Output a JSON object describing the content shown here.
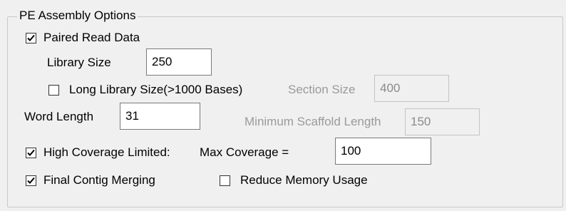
{
  "group": {
    "title": "PE Assembly Options"
  },
  "paired_read": {
    "label": "Paired Read Data",
    "checked": true
  },
  "library_size": {
    "label": "Library Size",
    "value": "250"
  },
  "long_library": {
    "label": "Long Library Size(>1000 Bases)",
    "checked": false
  },
  "section_size": {
    "label": "Section Size",
    "value": "400",
    "enabled": false
  },
  "word_length": {
    "label": "Word Length",
    "value": "31"
  },
  "min_scaffold": {
    "label": "Minimum Scaffold Length",
    "value": "150",
    "enabled": false
  },
  "high_coverage": {
    "label": "High Coverage Limited:",
    "checked": true
  },
  "max_coverage": {
    "label": "Max Coverage =",
    "value": "100"
  },
  "final_merging": {
    "label": "Final Contig Merging",
    "checked": true
  },
  "reduce_memory": {
    "label": "Reduce Memory Usage",
    "checked": false
  },
  "icons": {
    "check": "checkmark-icon"
  }
}
